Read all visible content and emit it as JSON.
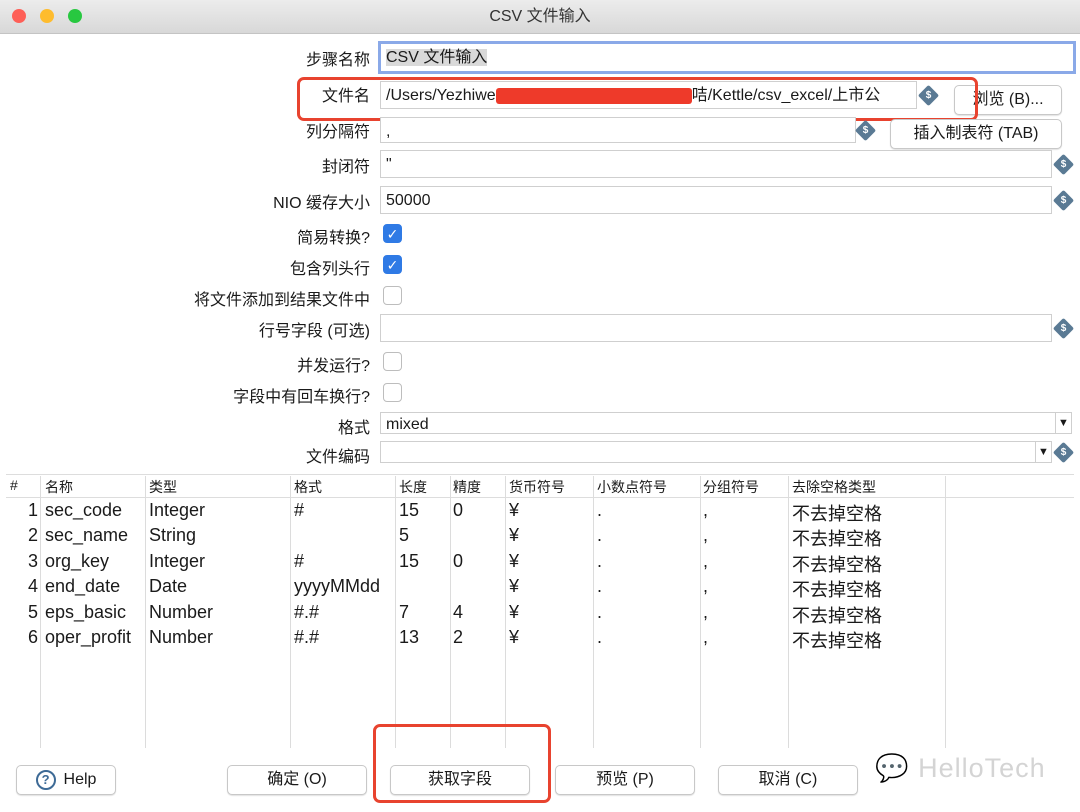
{
  "window": {
    "title": "CSV 文件输入"
  },
  "form": {
    "step_name": {
      "label": "步骤名称",
      "value": "CSV 文件输入"
    },
    "filename": {
      "label": "文件名",
      "value_prefix": "/Users/Yezhiwe",
      "value_suffix": "咭/Kettle/csv_excel/上市公",
      "browse": "浏览 (B)..."
    },
    "delimiter": {
      "label": "列分隔符",
      "value": ",",
      "insert_tab": "插入制表符 (TAB)"
    },
    "enclosure": {
      "label": "封闭符",
      "value": "\""
    },
    "nio_buffer": {
      "label": "NIO 缓存大小",
      "value": "50000"
    },
    "lazy_conversion": {
      "label": "简易转换?",
      "checked": true
    },
    "header_row": {
      "label": "包含列头行",
      "checked": true
    },
    "add_to_result": {
      "label": "将文件添加到结果文件中",
      "checked": false
    },
    "row_number_field": {
      "label": "行号字段 (可选)",
      "value": ""
    },
    "parallel": {
      "label": "并发运行?",
      "checked": false
    },
    "newline_in_fields": {
      "label": "字段中有回车换行?",
      "checked": false
    },
    "format": {
      "label": "格式",
      "value": "mixed"
    },
    "encoding": {
      "label": "文件编码",
      "value": ""
    }
  },
  "table": {
    "headers": [
      "#",
      "名称",
      "类型",
      "格式",
      "长度",
      "精度",
      "货币符号",
      "小数点符号",
      "分组符号",
      "去除空格类型"
    ],
    "rows": [
      [
        "1",
        "sec_code",
        "Integer",
        "#",
        "15",
        "0",
        "¥",
        ".",
        ",",
        "不去掉空格"
      ],
      [
        "2",
        "sec_name",
        "String",
        "",
        "5",
        "",
        "¥",
        ".",
        ",",
        "不去掉空格"
      ],
      [
        "3",
        "org_key",
        "Integer",
        "#",
        "15",
        "0",
        "¥",
        ".",
        ",",
        "不去掉空格"
      ],
      [
        "4",
        "end_date",
        "Date",
        "yyyyMMdd",
        "",
        "",
        "¥",
        ".",
        ",",
        "不去掉空格"
      ],
      [
        "5",
        "eps_basic",
        "Number",
        "#.#",
        "7",
        "4",
        "¥",
        ".",
        ",",
        "不去掉空格"
      ],
      [
        "6",
        "oper_profit",
        "Number",
        "#.#",
        "13",
        "2",
        "¥",
        ".",
        ",",
        "不去掉空格"
      ]
    ]
  },
  "buttons": {
    "help": "Help",
    "ok": "确定 (O)",
    "get_fields": "获取字段",
    "preview": "预览 (P)",
    "cancel": "取消 (C)"
  },
  "watermark": "HelloTech",
  "colors": {
    "accent": "#2f7ae5",
    "highlight": "#e8432f"
  }
}
